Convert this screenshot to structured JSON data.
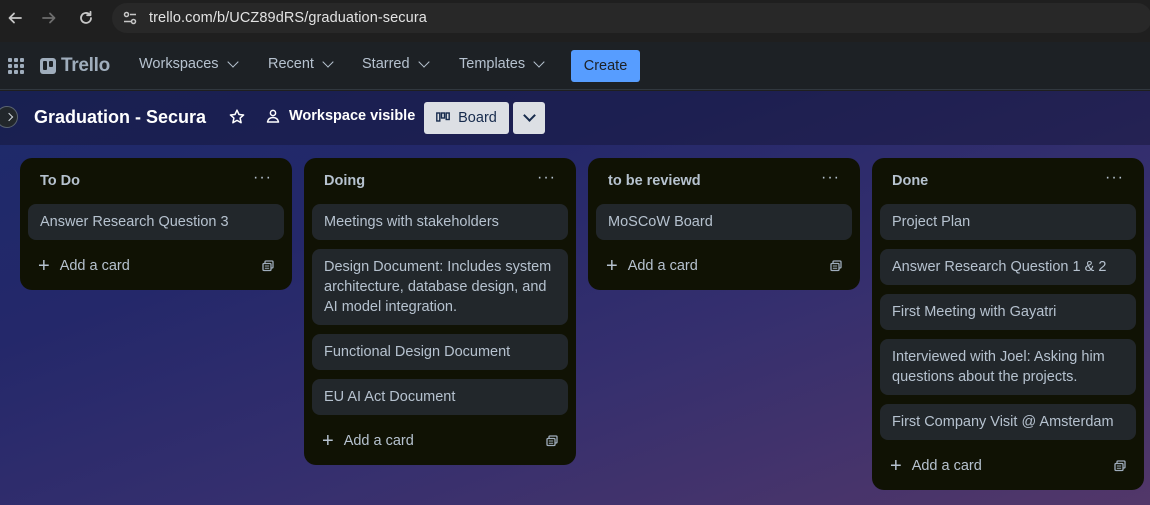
{
  "browser": {
    "url": "trello.com/b/UCZ89dRS/graduation-secura"
  },
  "header": {
    "logo": "Trello",
    "menu": [
      {
        "label": "Workspaces"
      },
      {
        "label": "Recent"
      },
      {
        "label": "Starred"
      },
      {
        "label": "Templates"
      }
    ],
    "create_label": "Create"
  },
  "board": {
    "title": "Graduation - Secura",
    "visibility": "Workspace visible",
    "view_label": "Board"
  },
  "lists": [
    {
      "title": "To Do",
      "cards": [
        "Answer Research Question 3"
      ],
      "add_label": "Add a card"
    },
    {
      "title": "Doing",
      "cards": [
        "Meetings with stakeholders",
        "Design Document: Includes system architecture, database design, and AI model integration.",
        "Functional Design Document",
        "EU AI Act Document"
      ],
      "add_label": "Add a card"
    },
    {
      "title": "to be reviewd",
      "cards": [
        "MoSCoW Board"
      ],
      "add_label": "Add a card"
    },
    {
      "title": "Done",
      "cards": [
        "Project Plan",
        "Answer Research Question 1 & 2",
        "First Meeting with Gayatri",
        "Interviewed with Joel: Asking him questions about the projects.",
        "First Company Visit @ Amsterdam"
      ],
      "add_label": "Add a card"
    }
  ],
  "icons": {
    "back": "arrow-left-icon",
    "forward": "arrow-right-icon",
    "reload": "reload-icon",
    "site_info": "tune-icon",
    "apps": "app-grid-icon",
    "star": "star-icon",
    "visibility": "people-icon",
    "board_view": "board-icon",
    "list_menu": "more-horizontal-icon",
    "add": "plus-icon",
    "template": "template-icon"
  },
  "colors": {
    "accent": "#579dff",
    "list_bg": "#101204",
    "card_bg": "#22272b",
    "header_bg": "#1d2125"
  }
}
